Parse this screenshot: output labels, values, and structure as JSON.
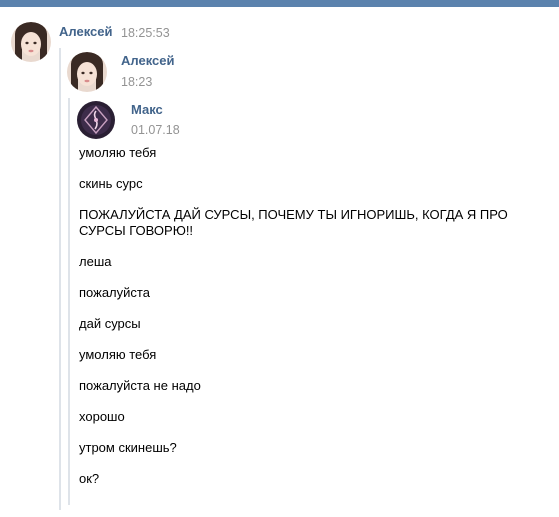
{
  "colors": {
    "topbar": "#5b82ad",
    "author_link": "#42648b",
    "timestamp": "#939393",
    "forward_line": "#dee3e9"
  },
  "message": {
    "author": "Алексей",
    "time": "18:25:53",
    "forwarded": {
      "author": "Алексей",
      "time": "18:23",
      "forwarded": {
        "author": "Макс",
        "date": "01.07.18",
        "lines": [
          "умоляю тебя",
          "скинь сурс",
          "ПОЖАЛУЙСТА ДАЙ СУРСЫ, ПОЧЕМУ ТЫ ИГНОРИШЬ, КОГДА Я ПРО СУРСЫ ГОВОРЮ!!",
          "леша",
          "пожалуйста",
          "дай сурсы",
          "умоляю тебя",
          "пожалуйста не надо",
          "хорошо",
          "утром скинешь?",
          "ок?"
        ]
      }
    }
  }
}
